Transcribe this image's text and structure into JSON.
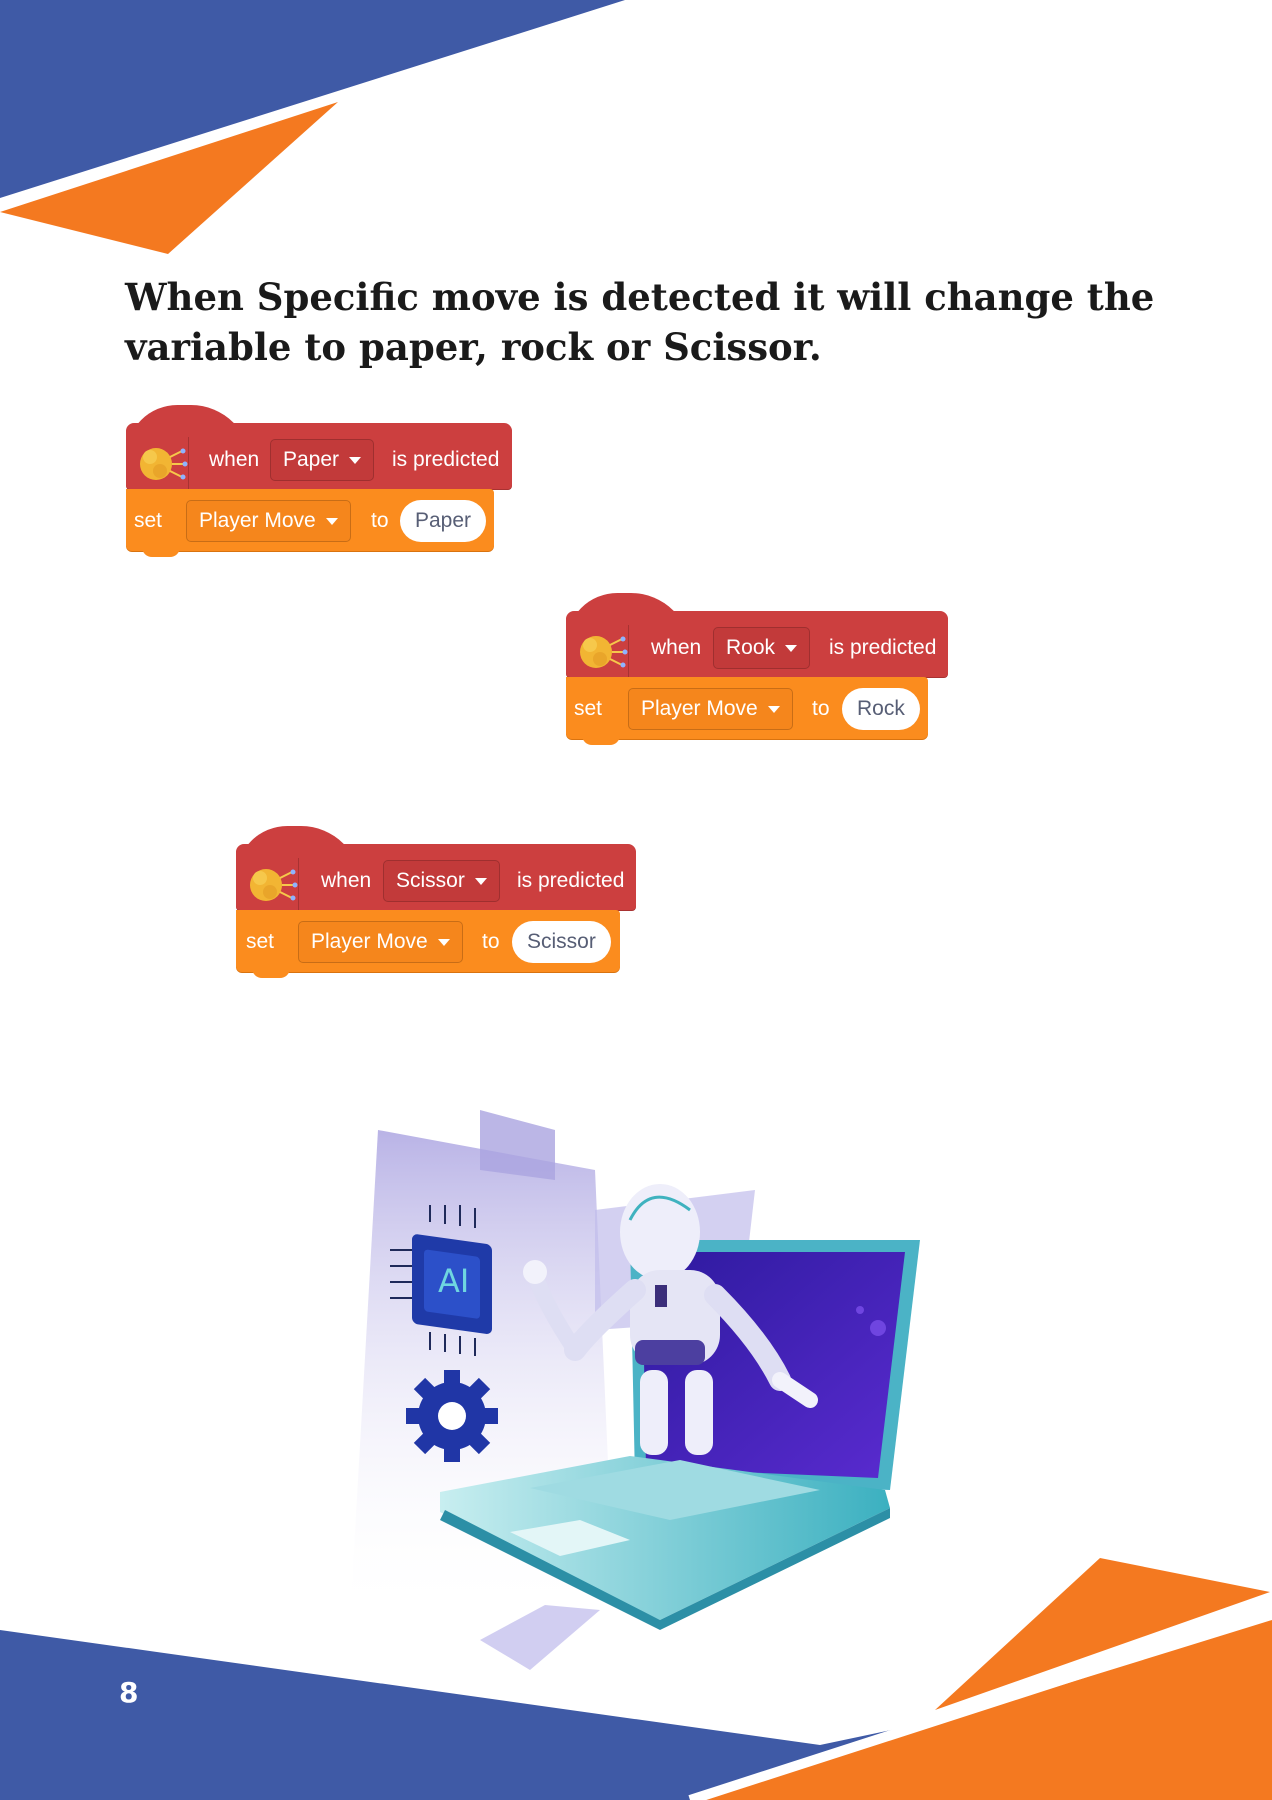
{
  "heading": "When Specific move is detected it will change the variable to paper, rock or Scissor.",
  "blocks": [
    {
      "when": "when",
      "class": "Paper",
      "predicted": "is predicted",
      "set": "set",
      "variable": "Player Move",
      "to": "to",
      "value": "Paper"
    },
    {
      "when": "when",
      "class": "Rook",
      "predicted": "is predicted",
      "set": "set",
      "variable": "Player Move",
      "to": "to",
      "value": "Rock"
    },
    {
      "when": "when",
      "class": "Scissor",
      "predicted": "is predicted",
      "set": "set",
      "variable": "Player Move",
      "to": "to",
      "value": "Scissor"
    }
  ],
  "illustration": {
    "chip_label": "AI"
  },
  "page_number": "8",
  "colors": {
    "blue": "#3f5aa6",
    "orange": "#f47920",
    "hat_red": "#cc3f3f",
    "block_orange": "#fb8c1e"
  }
}
